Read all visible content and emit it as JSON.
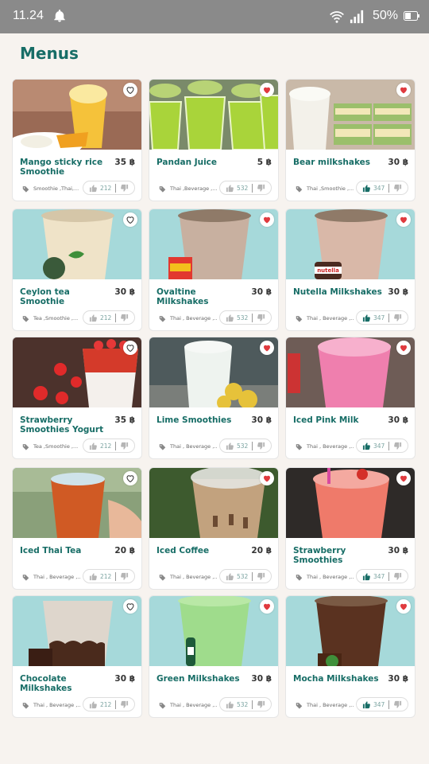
{
  "status_bar": {
    "time": "11.24",
    "battery": "50%"
  },
  "page": {
    "title": "Menus"
  },
  "colors": {
    "accent": "#176d66",
    "heart": "#e03a3e",
    "status_bar": "#8a8a8a"
  },
  "items": [
    {
      "name": "Mango sticky rice Smoothie",
      "price": "35 ฿",
      "tags": "Smoothie ,Thai,...",
      "votes": "212",
      "liked": false,
      "favorite": false,
      "image": "mango-sticky-rice-smoothie"
    },
    {
      "name": "Pandan Juice",
      "price": "5 ฿",
      "tags": "Thai ,Beverage ,...",
      "votes": "532",
      "liked": false,
      "favorite": true,
      "image": "pandan-juice"
    },
    {
      "name": "Bear milkshakes",
      "price": "30 ฿",
      "tags": "Thai ,Smoothie ,...",
      "votes": "347",
      "liked": true,
      "favorite": true,
      "image": "bear-milkshakes"
    },
    {
      "name": "Ceylon tea Smoothie",
      "price": "30 ฿",
      "tags": "Tea ,Smoothie ,...",
      "votes": "212",
      "liked": false,
      "favorite": false,
      "image": "ceylon-tea-smoothie"
    },
    {
      "name": "Ovaltine Milkshakes",
      "price": "30 ฿",
      "tags": "Thai , Beverage ,...",
      "votes": "532",
      "liked": false,
      "favorite": true,
      "image": "ovaltine-milkshakes"
    },
    {
      "name": "Nutella Milkshakes",
      "price": "30 ฿",
      "tags": "Thai , Beverage ,...",
      "votes": "347",
      "liked": true,
      "favorite": true,
      "image": "nutella-milkshakes"
    },
    {
      "name": "Strawberry Smoothies Yogurt",
      "price": "35 ฿",
      "tags": "Tea ,Smoothie ,...",
      "votes": "212",
      "liked": false,
      "favorite": false,
      "image": "strawberry-smoothies-yogurt"
    },
    {
      "name": "Lime Smoothies",
      "price": "30 ฿",
      "tags": "Thai , Beverage ,...",
      "votes": "532",
      "liked": false,
      "favorite": true,
      "image": "lime-smoothies"
    },
    {
      "name": "Iced Pink Milk",
      "price": "30 ฿",
      "tags": "Thai , Beverage ,...",
      "votes": "347",
      "liked": true,
      "favorite": true,
      "image": "iced-pink-milk"
    },
    {
      "name": "Iced Thai Tea",
      "price": "20 ฿",
      "tags": "Thai , Beverage ,...",
      "votes": "212",
      "liked": false,
      "favorite": false,
      "image": "iced-thai-tea"
    },
    {
      "name": "Iced Coffee",
      "price": "20 ฿",
      "tags": "Thai , Beverage ,...",
      "votes": "532",
      "liked": false,
      "favorite": true,
      "image": "iced-coffee"
    },
    {
      "name": "Strawberry Smoothies",
      "price": "30 ฿",
      "tags": "Thai , Beverage ,...",
      "votes": "347",
      "liked": true,
      "favorite": true,
      "image": "strawberry-smoothies"
    },
    {
      "name": "Chocolate Milkshakes",
      "price": "30 ฿",
      "tags": "Thai , Beverage ,...",
      "votes": "212",
      "liked": false,
      "favorite": false,
      "image": "chocolate-milkshakes"
    },
    {
      "name": "Green Milkshakes",
      "price": "30 ฿",
      "tags": "Thai , Beverage ,...",
      "votes": "532",
      "liked": false,
      "favorite": true,
      "image": "green-milkshakes"
    },
    {
      "name": "Mocha Milkshakes",
      "price": "30 ฿",
      "tags": "Thai , Beverage ,...",
      "votes": "347",
      "liked": true,
      "favorite": true,
      "image": "mocha-milkshakes"
    }
  ]
}
